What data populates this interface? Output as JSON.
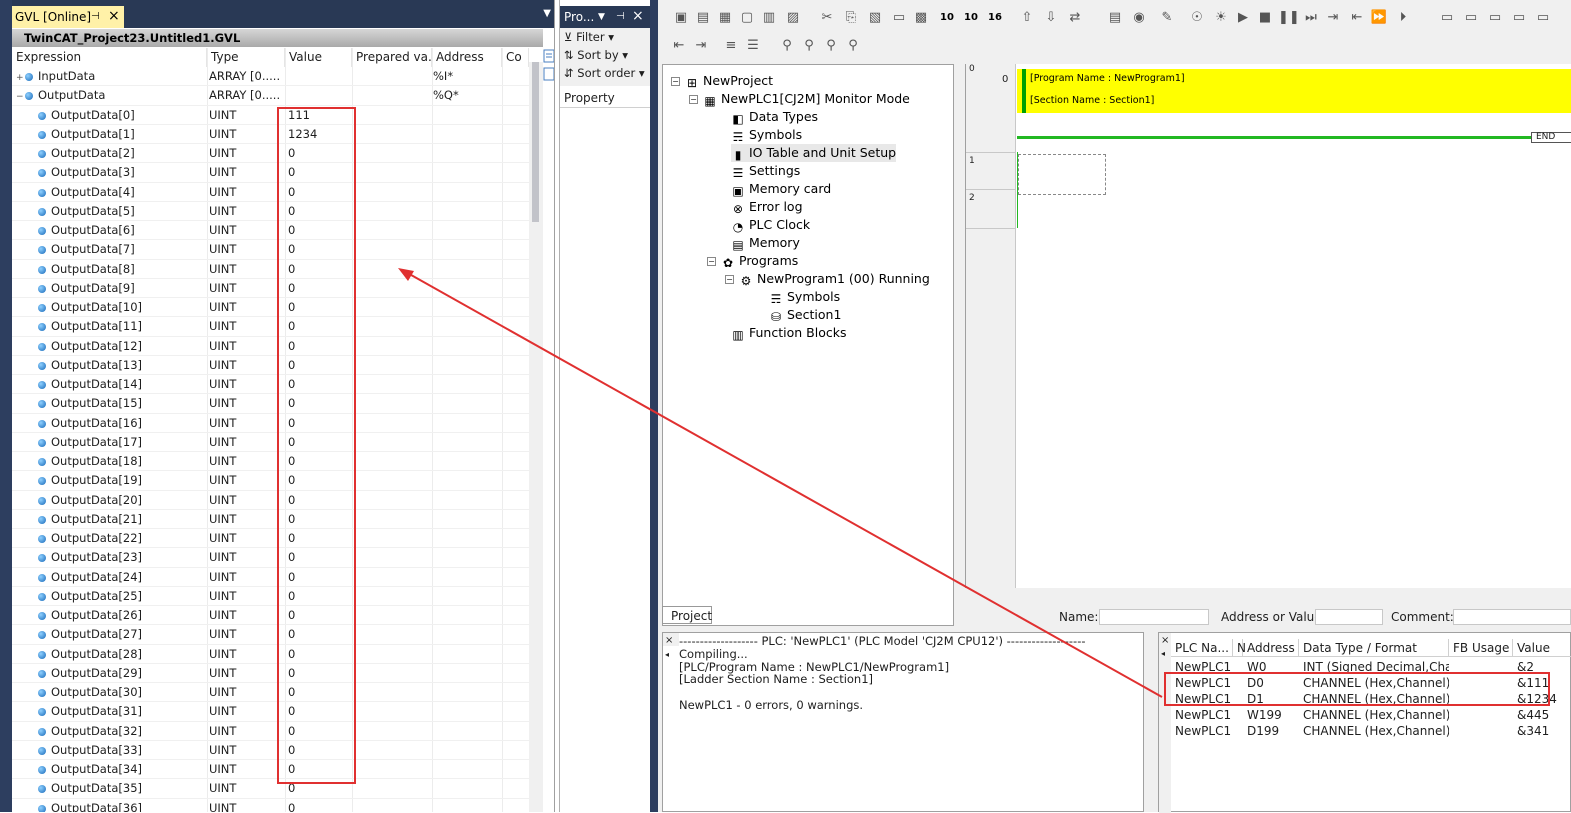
{
  "gvl": {
    "tab_label": "GVL [Online]",
    "pin_icon": "pin-icon",
    "close_icon": "close-icon",
    "dropdown_icon": "chevron-down-icon",
    "title": "TwinCAT_Project23.Untitled1.GVL",
    "columns": [
      "Expression",
      "Type",
      "Value",
      "Prepared va...",
      "Address",
      "Co"
    ],
    "rows": [
      {
        "expr": "InputData",
        "type": "ARRAY [0.....",
        "value": "",
        "addr": "%I*",
        "toggle": "+"
      },
      {
        "expr": "OutputData",
        "type": "ARRAY [0.....",
        "value": "",
        "addr": "%Q*",
        "toggle": "−"
      },
      {
        "expr": "OutputData[0]",
        "type": "UINT",
        "value": "111"
      },
      {
        "expr": "OutputData[1]",
        "type": "UINT",
        "value": "1234"
      },
      {
        "expr": "OutputData[2]",
        "type": "UINT",
        "value": "0"
      },
      {
        "expr": "OutputData[3]",
        "type": "UINT",
        "value": "0"
      },
      {
        "expr": "OutputData[4]",
        "type": "UINT",
        "value": "0"
      },
      {
        "expr": "OutputData[5]",
        "type": "UINT",
        "value": "0"
      },
      {
        "expr": "OutputData[6]",
        "type": "UINT",
        "value": "0"
      },
      {
        "expr": "OutputData[7]",
        "type": "UINT",
        "value": "0"
      },
      {
        "expr": "OutputData[8]",
        "type": "UINT",
        "value": "0"
      },
      {
        "expr": "OutputData[9]",
        "type": "UINT",
        "value": "0"
      },
      {
        "expr": "OutputData[10]",
        "type": "UINT",
        "value": "0"
      },
      {
        "expr": "OutputData[11]",
        "type": "UINT",
        "value": "0"
      },
      {
        "expr": "OutputData[12]",
        "type": "UINT",
        "value": "0"
      },
      {
        "expr": "OutputData[13]",
        "type": "UINT",
        "value": "0"
      },
      {
        "expr": "OutputData[14]",
        "type": "UINT",
        "value": "0"
      },
      {
        "expr": "OutputData[15]",
        "type": "UINT",
        "value": "0"
      },
      {
        "expr": "OutputData[16]",
        "type": "UINT",
        "value": "0"
      },
      {
        "expr": "OutputData[17]",
        "type": "UINT",
        "value": "0"
      },
      {
        "expr": "OutputData[18]",
        "type": "UINT",
        "value": "0"
      },
      {
        "expr": "OutputData[19]",
        "type": "UINT",
        "value": "0"
      },
      {
        "expr": "OutputData[20]",
        "type": "UINT",
        "value": "0"
      },
      {
        "expr": "OutputData[21]",
        "type": "UINT",
        "value": "0"
      },
      {
        "expr": "OutputData[22]",
        "type": "UINT",
        "value": "0"
      },
      {
        "expr": "OutputData[23]",
        "type": "UINT",
        "value": "0"
      },
      {
        "expr": "OutputData[24]",
        "type": "UINT",
        "value": "0"
      },
      {
        "expr": "OutputData[25]",
        "type": "UINT",
        "value": "0"
      },
      {
        "expr": "OutputData[26]",
        "type": "UINT",
        "value": "0"
      },
      {
        "expr": "OutputData[27]",
        "type": "UINT",
        "value": "0"
      },
      {
        "expr": "OutputData[28]",
        "type": "UINT",
        "value": "0"
      },
      {
        "expr": "OutputData[29]",
        "type": "UINT",
        "value": "0"
      },
      {
        "expr": "OutputData[30]",
        "type": "UINT",
        "value": "0"
      },
      {
        "expr": "OutputData[31]",
        "type": "UINT",
        "value": "0"
      },
      {
        "expr": "OutputData[32]",
        "type": "UINT",
        "value": "0"
      },
      {
        "expr": "OutputData[33]",
        "type": "UINT",
        "value": "0"
      },
      {
        "expr": "OutputData[34]",
        "type": "UINT",
        "value": "0"
      },
      {
        "expr": "OutputData[35]",
        "type": "UINT",
        "value": "0"
      },
      {
        "expr": "OutputData[36]",
        "type": "UINT",
        "value": "0"
      }
    ]
  },
  "properties": {
    "header": "Pro...",
    "filter": "Filter",
    "sort_by": "Sort by",
    "sort_order": "Sort order",
    "property_label": "Property"
  },
  "cx": {
    "project_tree": [
      {
        "label": "NewProject",
        "icon": "project-icon"
      },
      {
        "label": "NewPLC1[CJ2M] Monitor Mode",
        "icon": "plc-icon"
      },
      {
        "label": "Data Types",
        "icon": "data-types-icon"
      },
      {
        "label": "Symbols",
        "icon": "symbols-icon"
      },
      {
        "label": "IO Table and Unit Setup",
        "icon": "io-table-icon"
      },
      {
        "label": "Settings",
        "icon": "settings-icon"
      },
      {
        "label": "Memory card",
        "icon": "memory-card-icon"
      },
      {
        "label": "Error log",
        "icon": "error-log-icon"
      },
      {
        "label": "PLC Clock",
        "icon": "clock-icon"
      },
      {
        "label": "Memory",
        "icon": "memory-icon"
      },
      {
        "label": "Programs",
        "icon": "programs-icon"
      },
      {
        "label": "NewProgram1 (00) Running",
        "icon": "program-icon"
      },
      {
        "label": "Symbols",
        "icon": "symbols-icon"
      },
      {
        "label": "Section1",
        "icon": "section-icon"
      },
      {
        "label": "Function Blocks",
        "icon": "function-blocks-icon"
      }
    ],
    "project_tab": "Project",
    "ladder": {
      "rung_numbers": [
        "0",
        "1",
        "2"
      ],
      "step_number": "0",
      "program_name": "[Program Name : NewProgram1]",
      "section_name": "[Section Name : Section1]",
      "end_label": "END"
    },
    "name_bar": {
      "name_label": "Name:",
      "address_label": "Address or Value:",
      "comment_label": "Comment:"
    },
    "output_lines": [
      "------------------- PLC: 'NewPLC1' (PLC Model 'CJ2M CPU12') -------------------",
      "Compiling...",
      "[PLC/Program Name : NewPLC1/NewProgram1]",
      "[Ladder Section Name : Section1]",
      "",
      "NewPLC1 - 0 errors, 0 warnings."
    ],
    "watch": {
      "columns": [
        "PLC Na...",
        "N",
        "Address",
        "Data Type / Format",
        "FB Usage",
        "Value"
      ],
      "rows": [
        {
          "plc": "NewPLC1",
          "addr": "W0",
          "fmt": "INT (Signed Decimal,Cha...",
          "value": "&2"
        },
        {
          "plc": "NewPLC1",
          "addr": "D0",
          "fmt": "CHANNEL (Hex,Channel)",
          "value": "&111"
        },
        {
          "plc": "NewPLC1",
          "addr": "D1",
          "fmt": "CHANNEL (Hex,Channel)",
          "value": "&1234"
        },
        {
          "plc": "NewPLC1",
          "addr": "W199",
          "fmt": "CHANNEL (Hex,Channel)",
          "value": "&445"
        },
        {
          "plc": "NewPLC1",
          "addr": "D199",
          "fmt": "CHANNEL (Hex,Channel)",
          "value": "&341"
        }
      ]
    }
  },
  "annotation_color": "#e03030"
}
